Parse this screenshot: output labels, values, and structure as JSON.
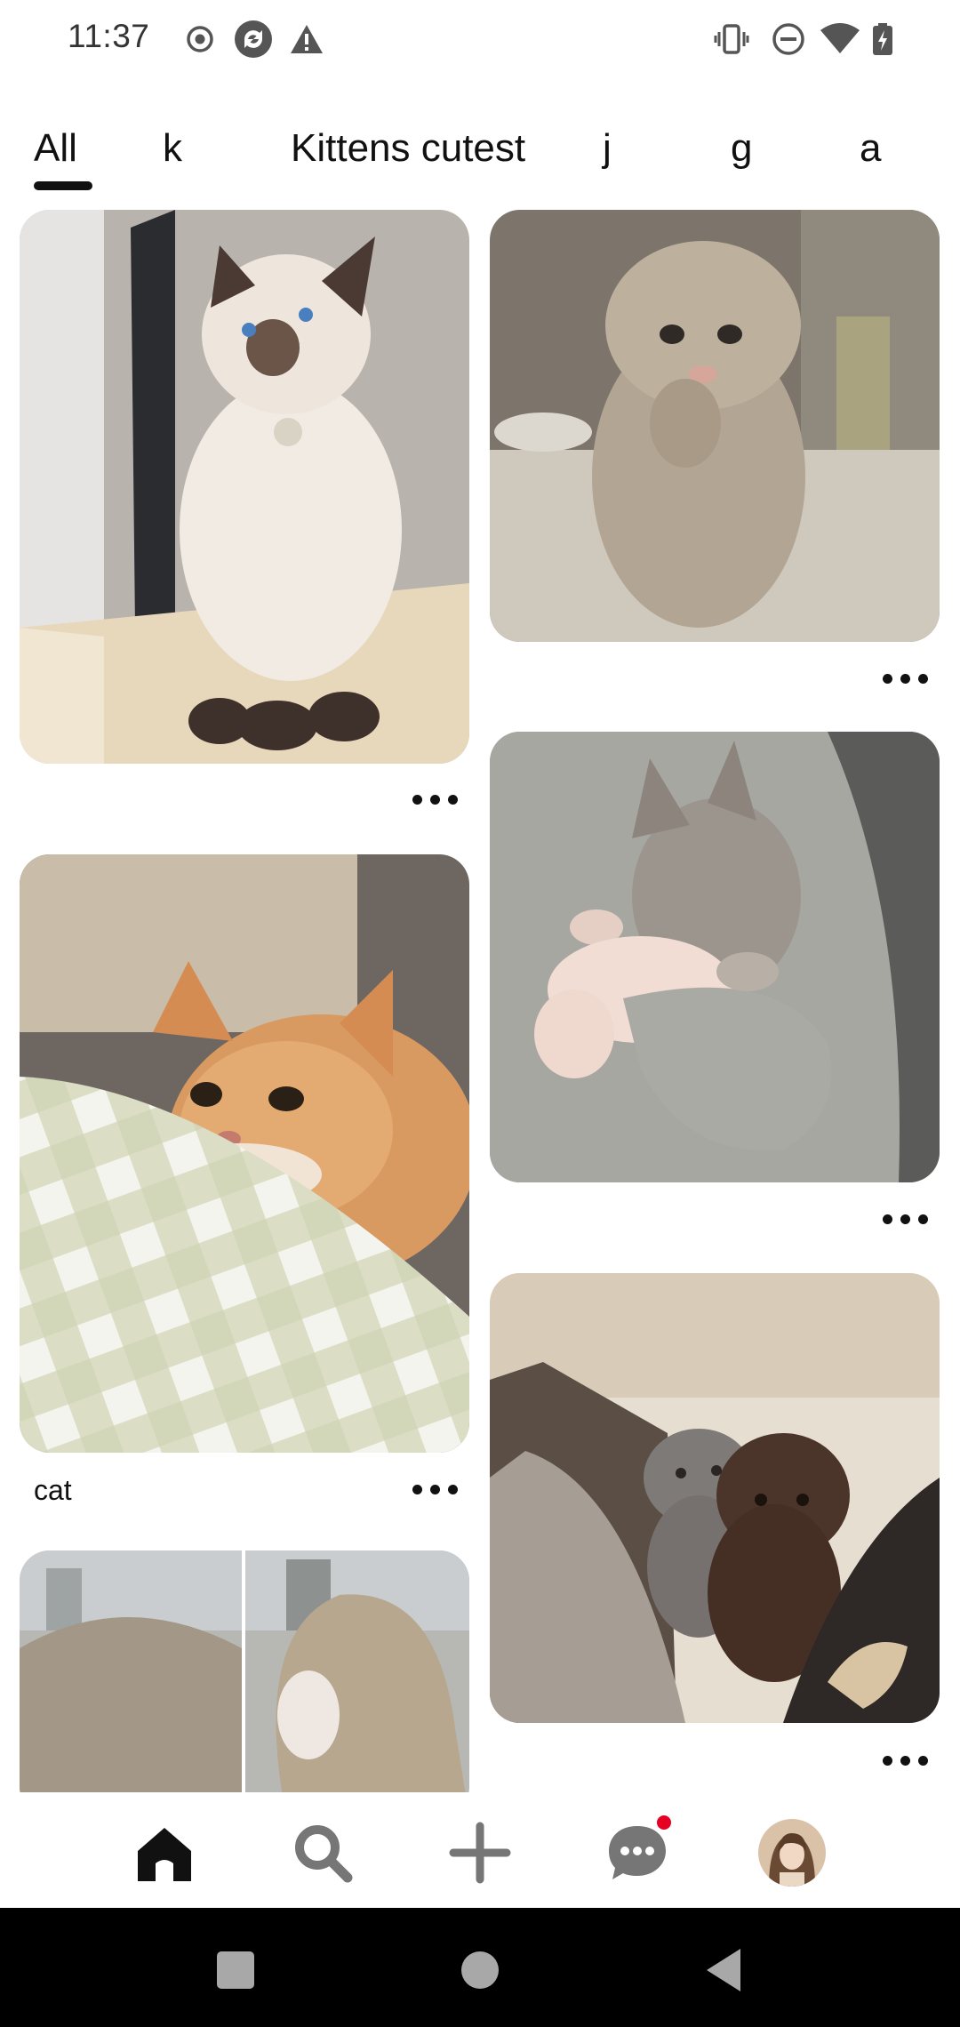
{
  "status_bar": {
    "time": "11:37",
    "left_icons": [
      "record-icon",
      "sync-icon",
      "warning-icon"
    ],
    "right_icons": [
      "vibrate-icon",
      "do-not-disturb-icon",
      "wifi-icon",
      "battery-icon"
    ]
  },
  "tabs": [
    {
      "label": "All",
      "selected": true
    },
    {
      "label": "k",
      "selected": false
    },
    {
      "label": "Kittens cutest",
      "selected": false
    },
    {
      "label": "j",
      "selected": false
    },
    {
      "label": "g",
      "selected": false
    },
    {
      "label": "a",
      "selected": false
    }
  ],
  "feed": {
    "pins": [
      {
        "image": "siamese-kitten-photo",
        "title": ""
      },
      {
        "image": "fluffy-grey-kitten-photo",
        "title": ""
      },
      {
        "image": "ginger-kitten-on-pillow-photo",
        "title": "cat"
      },
      {
        "image": "kitten-held-in-hands-photo",
        "title": ""
      },
      {
        "image": "girl-hair-photo",
        "title": ""
      },
      {
        "image": "two-scottish-fold-kittens-photo",
        "title": ""
      }
    ],
    "more_icon": "more-options-icon"
  },
  "bottom_nav": {
    "items": [
      "home-icon",
      "search-icon",
      "create-icon",
      "messages-icon",
      "profile-avatar"
    ],
    "active": "home-icon",
    "messages_has_notification": true,
    "notification_color": "#e60023"
  },
  "system_nav": {
    "items": [
      "recents-button",
      "home-button",
      "back-button"
    ]
  }
}
